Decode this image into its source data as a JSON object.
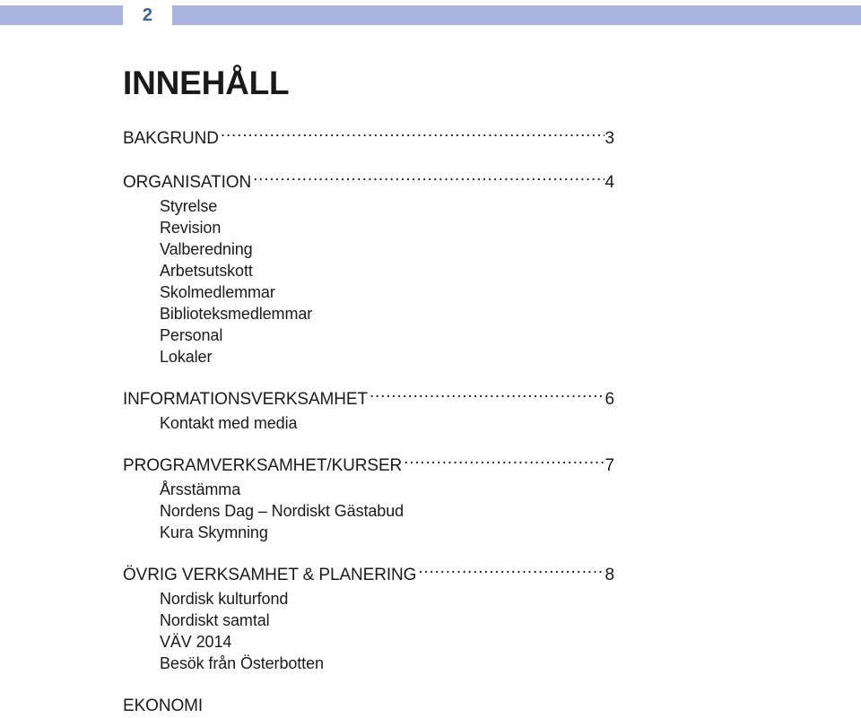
{
  "header": {
    "page_number": "2",
    "band_color": "#aab4dc",
    "page_number_color": "#3c6397"
  },
  "document": {
    "title": "INNEHÅLL"
  },
  "toc": {
    "entries": [
      {
        "label": "BAKGRUND",
        "page": "3",
        "has_leader": true,
        "subitems": []
      },
      {
        "label": "ORGANISATION",
        "page": "4",
        "has_leader": true,
        "subitems": [
          "Styrelse",
          "Revision",
          "Valberedning",
          "Arbetsutskott",
          "Skolmedlemmar",
          "Biblioteksmedlemmar",
          "Personal",
          "Lokaler"
        ]
      },
      {
        "label": "INFORMATIONSVERKSAMHET",
        "page": "6",
        "has_leader": true,
        "subitems": [
          "Kontakt med media"
        ]
      },
      {
        "label": "PROGRAMVERKSAMHET/KURSER",
        "page": "7",
        "has_leader": true,
        "subitems": [
          "Årsstämma",
          "Nordens Dag – Nordiskt Gästabud",
          "Kura Skymning"
        ]
      },
      {
        "label": "ÖVRIG VERKSAMHET & PLANERING",
        "page": "8",
        "has_leader": true,
        "subitems": [
          "Nordisk kulturfond",
          "Nordiskt samtal",
          "VÄV 2014",
          "Besök från Österbotten"
        ]
      },
      {
        "label": "EKONOMI",
        "page": "",
        "has_leader": false,
        "subitems": []
      }
    ]
  }
}
